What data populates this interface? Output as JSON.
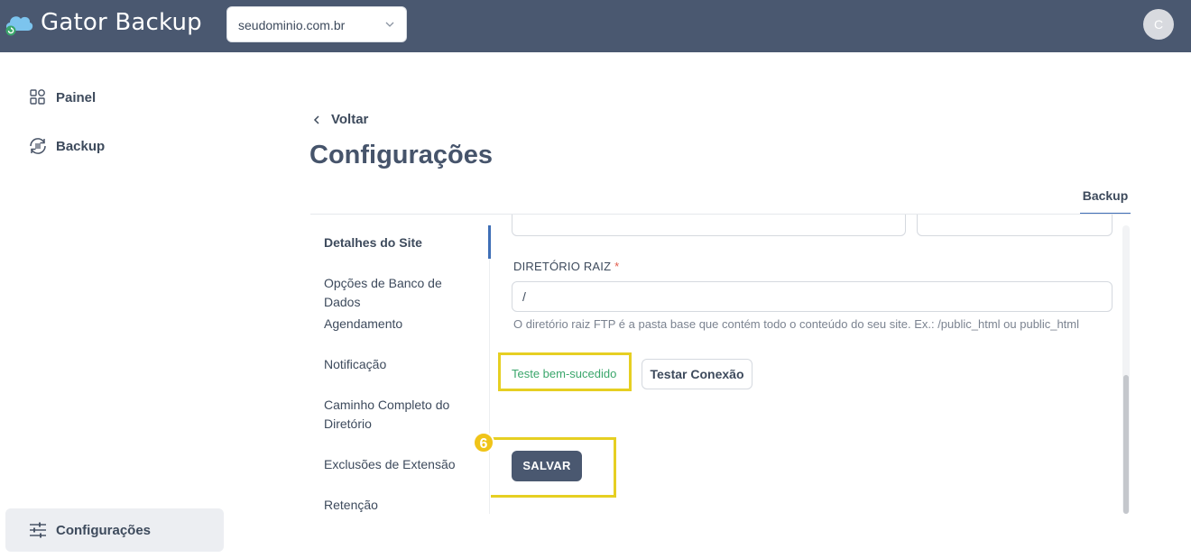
{
  "app": {
    "title": "Gator Backup"
  },
  "header": {
    "domain_selected": "seudominio.com.br",
    "avatar_initial": "C"
  },
  "sidebar": {
    "items": [
      {
        "label": "Painel",
        "icon": "dashboard-grid-icon"
      },
      {
        "label": "Backup",
        "icon": "backup-sync-icon"
      }
    ],
    "bottom": {
      "label": "Configurações",
      "icon": "sliders-icon"
    }
  },
  "main": {
    "back_label": "Voltar",
    "title": "Configurações",
    "tab_label": "Backup",
    "sections": [
      "Detalhes do Site",
      "Opções de Banco de Dados",
      "Agendamento",
      "Notificação",
      "Caminho Completo do Diretório",
      "Exclusões de Extensão",
      "Retenção"
    ],
    "active_section": "Detalhes do Site",
    "root_dir": {
      "label": "DIRETÓRIO RAIZ",
      "required_mark": "*",
      "value": "/",
      "help": "O diretório raiz FTP é a pasta base que contém todo o conteúdo do seu site. Ex.: /public_html ou public_html"
    },
    "test_status": "Teste bem-sucedido",
    "test_button": "Testar Conexão",
    "save_button": "SALVAR",
    "step_number": "6"
  },
  "colors": {
    "topbar": "#4a5870",
    "accent": "#3f6fb6",
    "success": "#3aa66b",
    "highlight": "#e6cf22",
    "step_badge": "#f0c419"
  }
}
